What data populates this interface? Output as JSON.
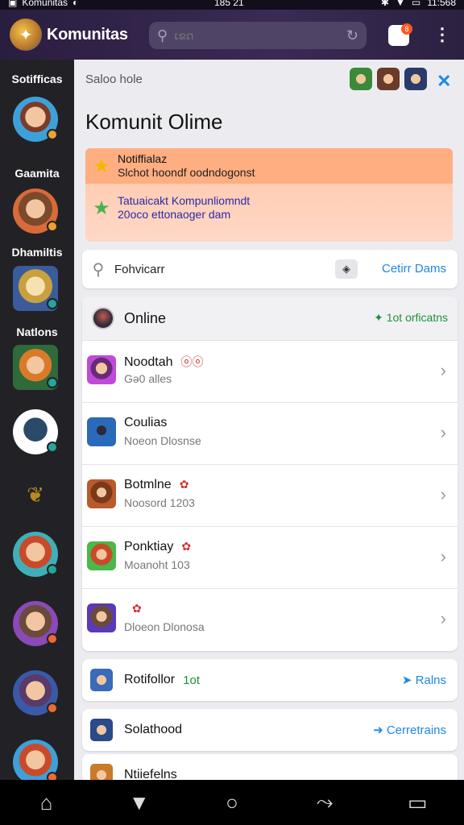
{
  "status_bar": {
    "app_name": "Komunitas",
    "time": "185 21",
    "battery": "11:568"
  },
  "app_bar": {
    "title": "Komunitas",
    "search_placeholder": "ເຂດ",
    "notification_count": "8"
  },
  "sidebar": {
    "labels": [
      "Sotifficas",
      "Gaamita",
      "Dhamiltis",
      "Natlons"
    ]
  },
  "main": {
    "breadcrumb": "Saloo hole",
    "page_title": "Komunit Olime",
    "notifications": [
      {
        "title": "Notiffialaz",
        "subtitle": "Slchot hoondf oodndogonst"
      },
      {
        "title": "Tatuaicakt Kompunliomndt",
        "subtitle": "20oco ettonaoger dam"
      }
    ],
    "search_card": {
      "label": "Fohvicarr",
      "link": "Cetirr Dams"
    },
    "online": {
      "title": "Online",
      "action": "1ot orficatns",
      "members": [
        {
          "name": "Noodtah",
          "tags": "ⓞⓞ",
          "meta": "Gə0 alles"
        },
        {
          "name": "Coulias",
          "tags": "",
          "meta": "Noeon Dlosnse"
        },
        {
          "name": "Botmlne",
          "tags": "✿",
          "meta": "Noosord 1203"
        },
        {
          "name": "Ponktiay",
          "tags": "✿",
          "meta": "Moanoht 103"
        },
        {
          "name": "",
          "tags": "✿",
          "meta": "Dloeon Dlonosa"
        }
      ]
    },
    "cards": [
      {
        "title": "Rotifollor",
        "badge": "1ot",
        "action": "Ralns"
      },
      {
        "title": "Solathood",
        "badge": "",
        "action": "Cerretrains"
      },
      {
        "title": "Ntiiefelns",
        "badge": "",
        "action": ""
      }
    ]
  },
  "colors": {
    "app_bar": "#2a1e3f",
    "accent_blue": "#1e88e5",
    "accent_green": "#1f8f3a",
    "notif_orange": "#ffae82"
  },
  "icons": {
    "search": "search-icon",
    "refresh": "refresh-icon",
    "more": "more-vert-icon",
    "close": "close-icon",
    "chevron": "chevron-right-icon",
    "home": "home-icon"
  }
}
